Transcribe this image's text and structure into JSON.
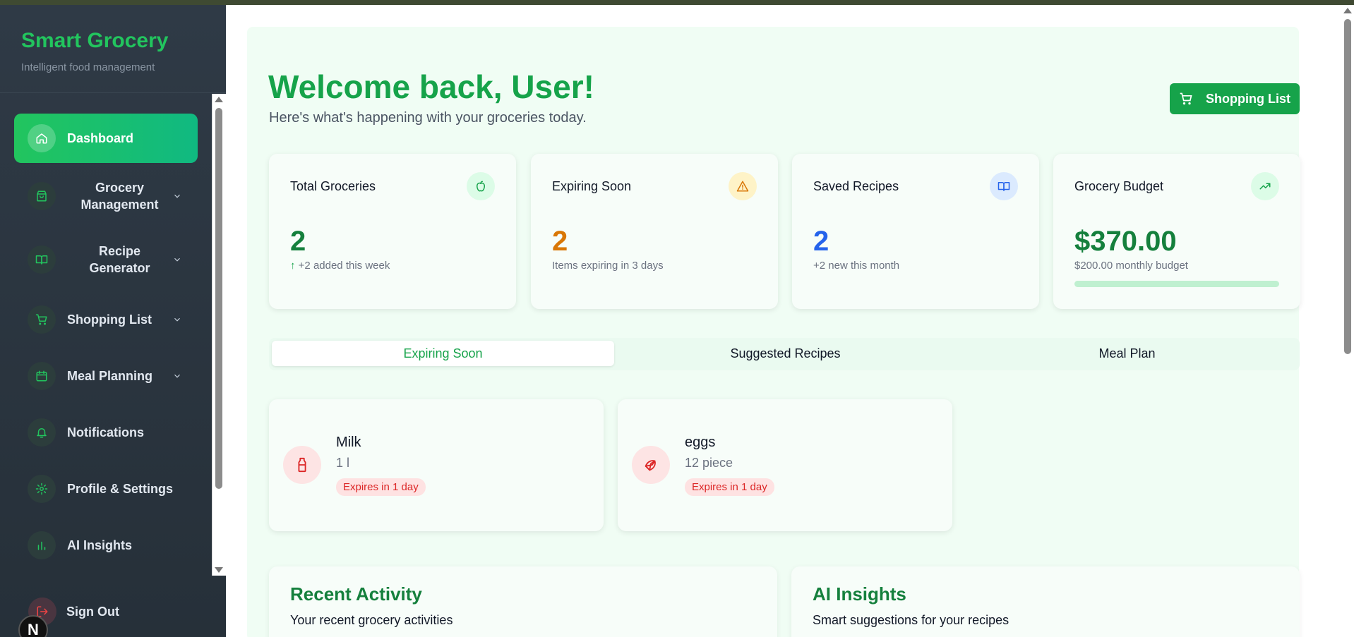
{
  "brand": {
    "title": "Smart Grocery",
    "subtitle": "Intelligent food management"
  },
  "sidebar": {
    "items": [
      {
        "label": "Dashboard",
        "icon": "home-icon"
      },
      {
        "label": "Grocery Management",
        "icon": "shopping-bag-icon"
      },
      {
        "label": "Recipe Generator",
        "icon": "book-icon"
      },
      {
        "label": "Shopping List",
        "icon": "cart-icon"
      },
      {
        "label": "Meal Planning",
        "icon": "calendar-icon"
      },
      {
        "label": "Notifications",
        "icon": "bell-icon"
      },
      {
        "label": "Profile & Settings",
        "icon": "gear-icon"
      },
      {
        "label": "AI Insights",
        "icon": "bar-chart-icon"
      }
    ],
    "sign_out": "Sign Out",
    "badge": "N"
  },
  "header": {
    "title": "Welcome back, User!",
    "subtitle": "Here's what's happening with your groceries today.",
    "shopping_button": "Shopping List"
  },
  "stats": [
    {
      "title": "Total Groceries",
      "value": "2",
      "note": "+2 added this week",
      "note_arrow": "↑",
      "color": "#15803d",
      "icon": "apple-icon"
    },
    {
      "title": "Expiring Soon",
      "value": "2",
      "note": "Items expiring in 3 days",
      "color": "#d97706",
      "icon": "warning-icon"
    },
    {
      "title": "Saved Recipes",
      "value": "2",
      "note": "+2 new this month",
      "color": "#2563eb",
      "icon": "book-open-icon"
    },
    {
      "title": "Grocery Budget",
      "value": "$370.00",
      "note": "$200.00 monthly budget",
      "color": "#15803d",
      "icon": "trending-up-icon",
      "budget_progress": 1.0
    }
  ],
  "tabs": [
    {
      "label": "Expiring Soon",
      "active": true
    },
    {
      "label": "Suggested Recipes",
      "active": false
    },
    {
      "label": "Meal Plan",
      "active": false
    }
  ],
  "expiring_items": [
    {
      "name": "Milk",
      "qty": "1 l",
      "expires": "Expires in 1 day",
      "icon": "milk-bottle-icon"
    },
    {
      "name": "eggs",
      "qty": "12 piece",
      "expires": "Expires in 1 day",
      "icon": "croissant-icon"
    }
  ],
  "sections": {
    "recent_activity": {
      "title": "Recent Activity",
      "subtitle": "Your recent grocery activities"
    },
    "ai_insights": {
      "title": "AI Insights",
      "subtitle": "Smart suggestions for your recipes"
    }
  }
}
